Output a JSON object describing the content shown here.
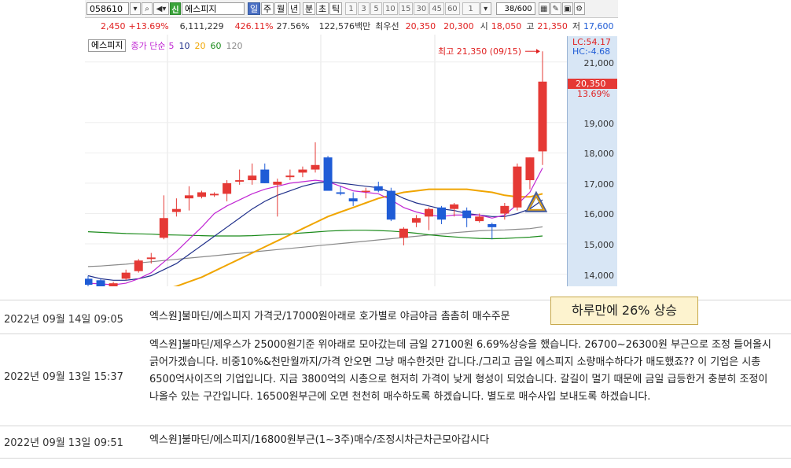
{
  "toolbar": {
    "code": "058610",
    "sin_label": "신",
    "name": "에스피지",
    "periods": [
      "일",
      "주",
      "월",
      "년",
      "분",
      "초",
      "틱"
    ],
    "active_period": "일",
    "intervals": [
      "1",
      "3",
      "5",
      "10",
      "15",
      "30",
      "45",
      "60",
      "1"
    ],
    "count": "38/600"
  },
  "info": {
    "change": "2,450",
    "change_pct": "+13.69%",
    "volume": "6,111,229",
    "volume_pct": "426.11%",
    "turnover": "27.56%",
    "amount": "122,576백만",
    "best_bid_label": "최우선",
    "best_ask": "20,350",
    "best_bid": "20,300",
    "open_label": "시",
    "open": "18,050",
    "high_label": "고",
    "high": "21,350",
    "low_label": "저",
    "low": "17,600"
  },
  "legend": {
    "name": "에스피지",
    "ma_label": "종가 단순",
    "ma_periods": [
      "5",
      "10",
      "20",
      "60",
      "120"
    ],
    "colors": {
      "5": "#c026d3",
      "10": "#1f2f8a",
      "20": "#f0a500",
      "60": "#1a8a1a",
      "120": "#8a8a8a"
    }
  },
  "axis": {
    "lc": "LC:54.17",
    "hc": "HC:-4.68",
    "ticks": [
      "21,000",
      "19,000",
      "18,000",
      "17,000",
      "16,000",
      "15,000",
      "14,000"
    ],
    "current_price": "20,350",
    "current_pct": "13.69%",
    "high_annotation": "최고 21,350 (09/15)"
  },
  "chart_data": {
    "type": "candlestick",
    "y_ticks": [
      14000,
      15000,
      16000,
      17000,
      18000,
      19000,
      21000
    ],
    "ylim": [
      13600,
      21900
    ],
    "up_color": "#e53935",
    "down_color": "#1f5cd6",
    "candles": [
      {
        "o": 13850,
        "h": 13950,
        "l": 13550,
        "c": 13650
      },
      {
        "o": 13800,
        "h": 13850,
        "l": 13500,
        "c": 13550
      },
      {
        "o": 13600,
        "h": 13750,
        "l": 13450,
        "c": 13700
      },
      {
        "o": 13850,
        "h": 14150,
        "l": 13800,
        "c": 14050
      },
      {
        "o": 14100,
        "h": 14500,
        "l": 14050,
        "c": 14450
      },
      {
        "o": 14500,
        "h": 14700,
        "l": 14350,
        "c": 14550
      },
      {
        "o": 15200,
        "h": 16600,
        "l": 15150,
        "c": 15850
      },
      {
        "o": 16050,
        "h": 16500,
        "l": 15900,
        "c": 16150
      },
      {
        "o": 16500,
        "h": 16900,
        "l": 16100,
        "c": 16600
      },
      {
        "o": 16550,
        "h": 16750,
        "l": 16500,
        "c": 16700
      },
      {
        "o": 16600,
        "h": 16700,
        "l": 16550,
        "c": 16650
      },
      {
        "o": 16650,
        "h": 17100,
        "l": 16400,
        "c": 17000
      },
      {
        "o": 17050,
        "h": 17450,
        "l": 16950,
        "c": 17100
      },
      {
        "o": 17100,
        "h": 17650,
        "l": 16950,
        "c": 17250
      },
      {
        "o": 17450,
        "h": 17650,
        "l": 17000,
        "c": 17000
      },
      {
        "o": 16950,
        "h": 17150,
        "l": 15900,
        "c": 17050
      },
      {
        "o": 17200,
        "h": 17450,
        "l": 17100,
        "c": 17250
      },
      {
        "o": 17350,
        "h": 17550,
        "l": 17200,
        "c": 17450
      },
      {
        "o": 17450,
        "h": 18350,
        "l": 17350,
        "c": 17600
      },
      {
        "o": 17850,
        "h": 17900,
        "l": 16800,
        "c": 16750
      },
      {
        "o": 16700,
        "h": 16900,
        "l": 16600,
        "c": 16650
      },
      {
        "o": 16500,
        "h": 16700,
        "l": 16250,
        "c": 16400
      },
      {
        "o": 16750,
        "h": 16850,
        "l": 16500,
        "c": 16750
      },
      {
        "o": 16900,
        "h": 17050,
        "l": 16700,
        "c": 16750
      },
      {
        "o": 16750,
        "h": 16850,
        "l": 15750,
        "c": 15800
      },
      {
        "o": 15200,
        "h": 15550,
        "l": 14950,
        "c": 15500
      },
      {
        "o": 15700,
        "h": 15950,
        "l": 15550,
        "c": 15850
      },
      {
        "o": 15900,
        "h": 16200,
        "l": 15450,
        "c": 16150
      },
      {
        "o": 16200,
        "h": 16250,
        "l": 15650,
        "c": 15800
      },
      {
        "o": 16150,
        "h": 16350,
        "l": 15900,
        "c": 16300
      },
      {
        "o": 16100,
        "h": 16200,
        "l": 15550,
        "c": 15850
      },
      {
        "o": 15750,
        "h": 16000,
        "l": 15700,
        "c": 15900
      },
      {
        "o": 15650,
        "h": 15700,
        "l": 15150,
        "c": 15550
      },
      {
        "o": 16000,
        "h": 16350,
        "l": 15800,
        "c": 16250
      },
      {
        "o": 16200,
        "h": 17650,
        "l": 16100,
        "c": 17550
      },
      {
        "o": 17100,
        "h": 17850,
        "l": 16800,
        "c": 17850
      },
      {
        "o": 18050,
        "h": 21350,
        "l": 17600,
        "c": 20350
      }
    ],
    "ma": {
      "5": [
        13700,
        13680,
        13650,
        13700,
        13850,
        14050,
        14400,
        14750,
        15150,
        15550,
        16000,
        16250,
        16450,
        16650,
        16800,
        16900,
        17000,
        17050,
        17100,
        17050,
        16900,
        16750,
        16700,
        16650,
        16450,
        16200,
        16050,
        15950,
        15900,
        15950,
        15950,
        15950,
        15850,
        15950,
        16300,
        16700,
        17500
      ],
      "10": [
        13950,
        13850,
        13800,
        13800,
        13850,
        13950,
        14150,
        14350,
        14650,
        14950,
        15250,
        15550,
        15850,
        16150,
        16400,
        16600,
        16750,
        16900,
        17000,
        17050,
        17000,
        16950,
        16900,
        16850,
        16700,
        16500,
        16350,
        16250,
        16150,
        16100,
        16000,
        15950,
        15900,
        15900,
        16000,
        16150,
        16450
      ],
      "20": [
        null,
        null,
        null,
        null,
        null,
        null,
        13500,
        13600,
        13750,
        13900,
        14100,
        14300,
        14500,
        14700,
        14900,
        15100,
        15300,
        15500,
        15700,
        15900,
        16050,
        16200,
        16350,
        16500,
        16600,
        16700,
        16750,
        16800,
        16800,
        16800,
        16800,
        16750,
        16700,
        16600,
        16550,
        16550,
        16650
      ],
      "60": [
        15400,
        15380,
        15360,
        15340,
        15330,
        15320,
        15300,
        15290,
        15280,
        15270,
        15260,
        15260,
        15260,
        15270,
        15290,
        15310,
        15330,
        15360,
        15390,
        15420,
        15440,
        15450,
        15450,
        15440,
        15420,
        15390,
        15350,
        15300,
        15260,
        15230,
        15200,
        15180,
        15170,
        15180,
        15200,
        15220,
        15260
      ],
      "120": [
        14250,
        14270,
        14300,
        14330,
        14370,
        14410,
        14450,
        14490,
        14530,
        14570,
        14610,
        14650,
        14690,
        14730,
        14770,
        14810,
        14850,
        14890,
        14930,
        14970,
        15010,
        15050,
        15090,
        15130,
        15170,
        15210,
        15250,
        15290,
        15330,
        15370,
        15400,
        15430,
        15450,
        15460,
        15480,
        15500,
        15560
      ]
    },
    "marker": {
      "index": 35,
      "price": 16300
    }
  },
  "callout": "하루만에 26% 상승",
  "feed": [
    {
      "date": "2022년 09월 14일 09:05",
      "message": "엑스원]불마딘/에스피지 가격굿/17000원아래로 호가별로 야금야금 촘촘히 매수주문"
    },
    {
      "date": "2022년 09월 13일 15:37",
      "message": "엑스원]불마딘/제우스가 25000원기준 위아래로 모아갔는데 금일 27100원 6.69%상승을 했습니다. 26700~26300원 부근으로 조정 들어올시 긁어가겠습니다. 비중10%&천만월까지/가격 안오면 그냥 매수한것만 갑니다./그리고 금일 에스피지 소량매수하다가 매도했죠?? 이 기업은 시총6500억사이즈의 기업입니다. 지금 3800억의 시총으로 현저히 가격이 낮게 형성이 되었습니다. 갈길이 멀기 때문에 금일 급등한거 충분히 조정이 나올수 있는 구간입니다. 16500원부근에 오면 천천히 매수하도록 하겠습니다. 별도로 매수사입 보내도록 하겠습니다."
    },
    {
      "date": "2022년 09월 13일 09:51",
      "message": "엑스원]불마딘/에스피지/16800원부근(1~3주)매수/조정시차근차근모아갑시다"
    }
  ]
}
